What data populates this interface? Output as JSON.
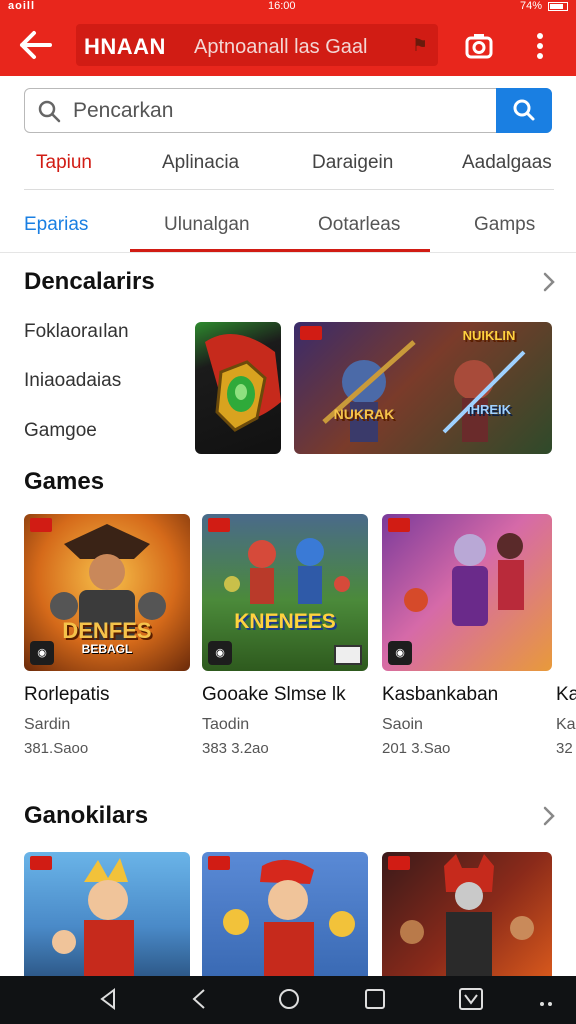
{
  "status_bar": {
    "left": "aoill",
    "time": "16:00",
    "right": "74%"
  },
  "app_bar": {
    "title": "HNAAN",
    "subtitle": "Aptnoanall las Gaal",
    "title_icon": "flag-icon",
    "icons": [
      "back-arrow-icon",
      "camera-icon",
      "more-vert-icon"
    ]
  },
  "search": {
    "placeholder": "Pencarkan",
    "button_icon": "search-icon"
  },
  "categories": [
    "Tapiun",
    "Aplinacia",
    "Daraigein",
    "Aadalgaas"
  ],
  "tabs": [
    "Eparias",
    "Ulunalgan",
    "Ootarleas",
    "Gamps"
  ],
  "colors": {
    "brand_red": "#e8261c",
    "accent_blue": "#1a7fe2",
    "nav_dark": "#101214"
  },
  "featured": {
    "title": "Dencalarirs",
    "side_items": [
      "Foklaoraılan",
      "Iniaoadaias",
      "Gamgoe"
    ],
    "banner_labels": [
      "NUIKLIN",
      "IHREIK"
    ]
  },
  "games": {
    "title": "Games",
    "cards": [
      {
        "title": "Rorlepatis",
        "sub": "Sardin",
        "meta": "381.Saoo",
        "art": "DENFES",
        "art2": "BEBAGL"
      },
      {
        "title": "Gooake Slmse lk",
        "sub": "Taodin",
        "meta": "383 3.2ao",
        "art": "KNENEES",
        "art2": ""
      },
      {
        "title": "Kasbankaban",
        "sub": "Saoin",
        "meta": "201 3.Sao",
        "art": "",
        "art2": ""
      },
      {
        "title": "Ka",
        "sub": "Ka",
        "meta": "32",
        "art": "",
        "art2": ""
      }
    ]
  },
  "bottom_section": {
    "title": "Ganokilars"
  },
  "nav_icons": [
    "nav-back-icon",
    "nav-recent-icon",
    "nav-home-icon",
    "nav-square-icon",
    "nav-check-icon",
    "nav-more-icon"
  ]
}
